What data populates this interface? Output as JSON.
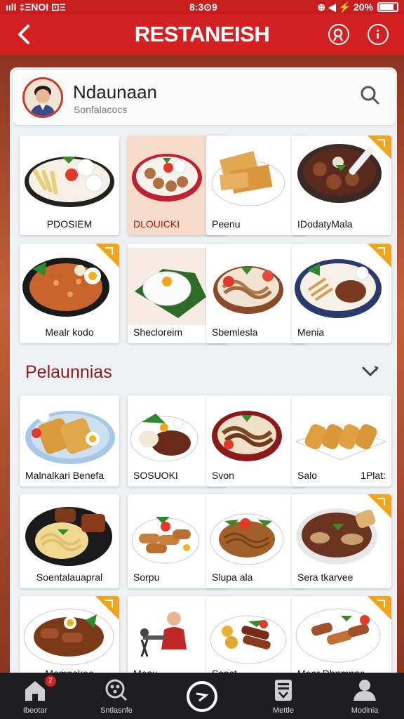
{
  "status_bar": {
    "left": "ııll ‡ΞNOI  ⊡Ξ",
    "center": "8:3⊙9",
    "right": "⊕ ◀ ⚡ 20%"
  },
  "header": {
    "title": "RESTANEISH"
  },
  "profile": {
    "name": "Ndaunaan",
    "subtitle": "Sonfalacocs"
  },
  "grid_top": [
    {
      "label": "PDOSIEM"
    },
    {
      "label": "DLOUICKI"
    },
    {
      "label": "Peenu"
    },
    {
      "label": "IDodatyMala"
    },
    {
      "label": "Mealr kodo"
    },
    {
      "label": "Shecloreim"
    },
    {
      "label": "Sbemlesla"
    },
    {
      "label": "Menia"
    }
  ],
  "section": {
    "title": "Pelaunnias"
  },
  "grid_bottom": [
    {
      "label": "Malnalkari Benefa"
    },
    {
      "label": "SOSUOKI"
    },
    {
      "label": "Svon"
    },
    {
      "label": "Salo",
      "label2": "1Plat:"
    },
    {
      "label": "Soentalauapral"
    },
    {
      "label": "Sorpu"
    },
    {
      "label": "Slupa ala"
    },
    {
      "label": "Sera tkarvee"
    },
    {
      "label": "Mompakee"
    },
    {
      "label": "Meau"
    },
    {
      "label": "Sapst"
    },
    {
      "label": "Mear Dhnmpne"
    }
  ],
  "nav": [
    {
      "label": "Ibeotar",
      "badge": "2"
    },
    {
      "label": "Sntlasnfe"
    },
    {
      "label": ""
    },
    {
      "label": "Mettle"
    },
    {
      "label": "Modinia"
    }
  ],
  "colors": {
    "primary_red": "#d42020",
    "nav_bg": "#1e1e22",
    "badge_orange": "#f2a51a"
  }
}
